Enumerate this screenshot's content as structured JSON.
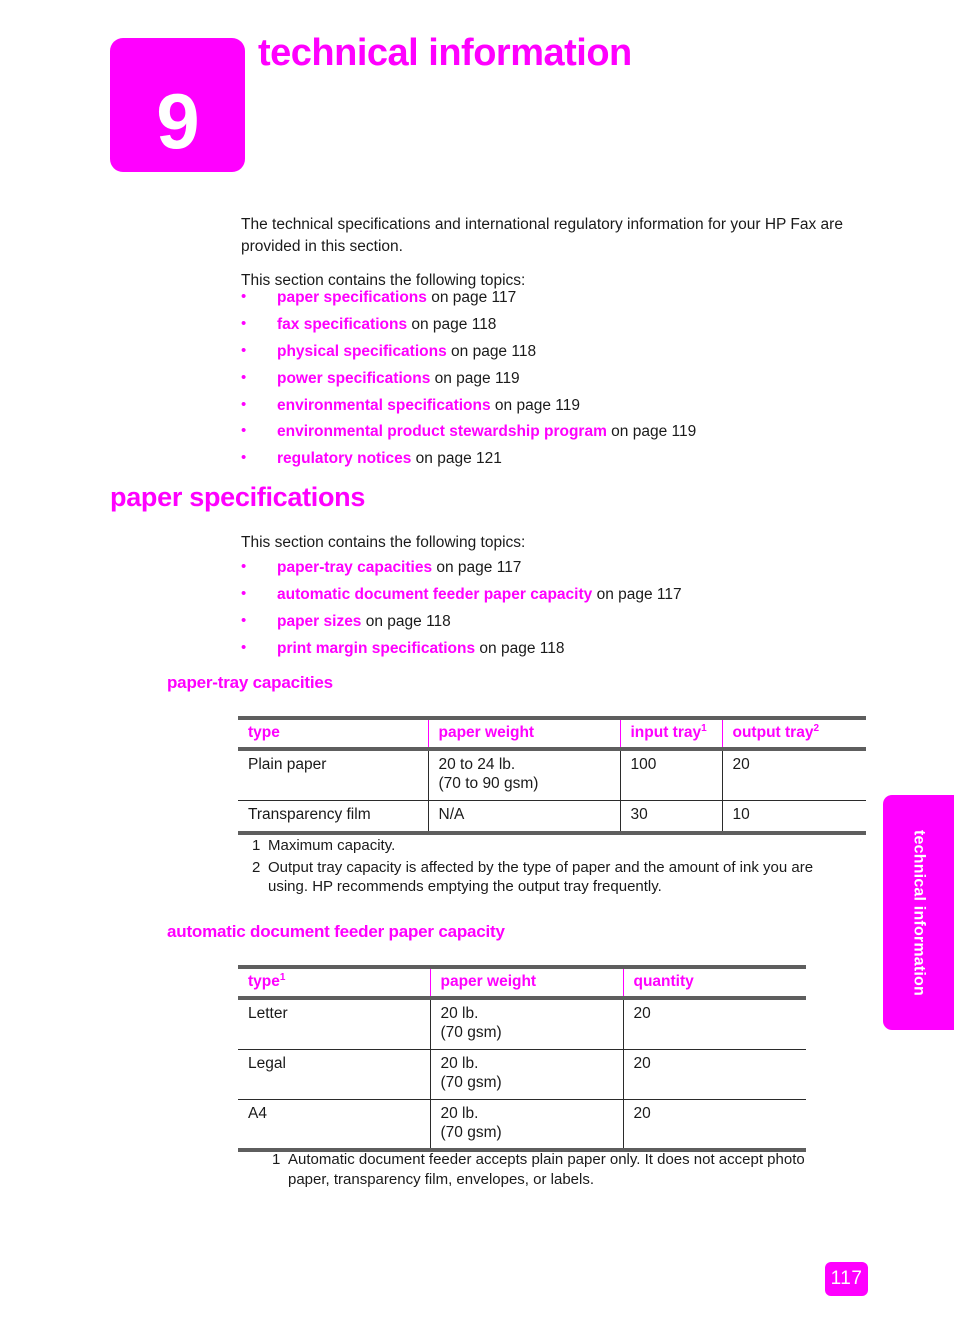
{
  "chapter": {
    "number": "9",
    "title": "technical information"
  },
  "intro": {
    "paragraph1": "The technical specifications and international regulatory information for your HP Fax are provided in this section.",
    "paragraph2": "This section contains the following topics:"
  },
  "topics": [
    {
      "link": "paper specifications",
      "suffix": " on page 117"
    },
    {
      "link": "fax specifications",
      "suffix": " on page 118"
    },
    {
      "link": "physical specifications",
      "suffix": " on page 118"
    },
    {
      "link": "power specifications",
      "suffix": " on page 119"
    },
    {
      "link": "environmental specifications",
      "suffix": " on page 119"
    },
    {
      "link": "environmental product stewardship program",
      "suffix": " on page 119"
    },
    {
      "link": "regulatory notices",
      "suffix": " on page 121"
    }
  ],
  "section": {
    "heading": "paper specifications",
    "lead": "This section contains the following topics:",
    "topics": [
      {
        "link": "paper-tray capacities",
        "suffix": " on page 117"
      },
      {
        "link": "automatic document feeder paper capacity",
        "suffix": " on page 117"
      },
      {
        "link": "paper sizes",
        "suffix": " on page 118"
      },
      {
        "link": "print margin specifications",
        "suffix": " on page 118"
      }
    ]
  },
  "paper_tray": {
    "heading": "paper-tray capacities",
    "columns": [
      {
        "label": "type",
        "sup": ""
      },
      {
        "label": "paper weight",
        "sup": ""
      },
      {
        "label": "input tray",
        "sup": "1"
      },
      {
        "label": "output tray",
        "sup": "2"
      }
    ],
    "rows": [
      {
        "type": "Plain paper",
        "weight_line1": "20 to 24 lb.",
        "weight_line2": "(70 to 90 gsm)",
        "input": "100",
        "output": "20"
      },
      {
        "type": "Transparency film",
        "weight_line1": "N/A",
        "weight_line2": "",
        "input": "30",
        "output": "10"
      }
    ],
    "footnotes": [
      {
        "num": "1",
        "text": "Maximum capacity."
      },
      {
        "num": "2",
        "text": "Output tray capacity is affected by the type of paper and the amount of ink you are using. HP recommends emptying the output tray frequently."
      }
    ]
  },
  "adf": {
    "heading": "automatic document feeder paper capacity",
    "columns": [
      {
        "label": "type",
        "sup": "1"
      },
      {
        "label": "paper weight",
        "sup": ""
      },
      {
        "label": "quantity",
        "sup": ""
      }
    ],
    "rows": [
      {
        "type": "Letter",
        "weight_line1": "20 lb.",
        "weight_line2": "(70 gsm)",
        "quantity": "20"
      },
      {
        "type": "Legal",
        "weight_line1": "20 lb.",
        "weight_line2": "(70 gsm)",
        "quantity": "20"
      },
      {
        "type": "A4",
        "weight_line1": "20 lb.",
        "weight_line2": "(70 gsm)",
        "quantity": "20"
      }
    ],
    "footnotes": [
      {
        "num": "1",
        "text": "Automatic document feeder accepts plain paper only. It does not accept photo paper, transparency film, envelopes, or labels."
      }
    ]
  },
  "side_tab": {
    "label": "technical information"
  },
  "page_number": "117",
  "colors": {
    "accent": "#ff00ff",
    "rule": "#5e5e5e",
    "text": "#1a1a1a"
  }
}
